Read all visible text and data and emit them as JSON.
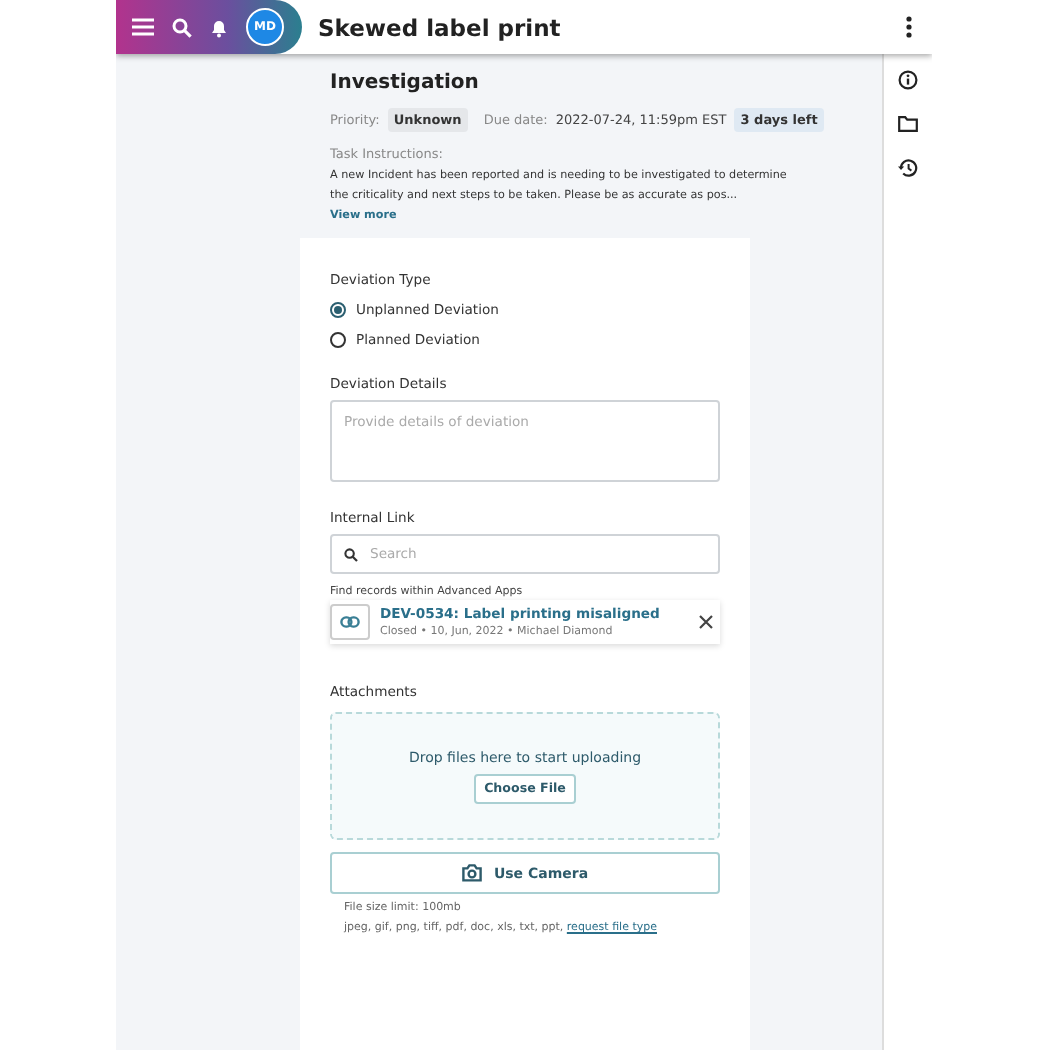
{
  "header": {
    "avatar": "MD",
    "title": "Skewed label print"
  },
  "task": {
    "title": "Investigation",
    "priority_label": "Priority:",
    "priority": "Unknown",
    "due_label": "Due date:",
    "due": "2022-07-24, 11:59pm EST",
    "due_badge": "3 days left",
    "instructions_label": "Task Instructions:",
    "instructions": "A new Incident has been reported and is needing to be investigated to determine the criticality and next steps to be taken. Please be as accurate as pos...",
    "view_more": "View more"
  },
  "form": {
    "type_label": "Deviation Type",
    "options": [
      {
        "label": "Unplanned Deviation",
        "selected": true
      },
      {
        "label": "Planned Deviation",
        "selected": false
      }
    ],
    "details_label": "Deviation Details",
    "details_placeholder": "Provide details of deviation",
    "link_label": "Internal Link",
    "search_placeholder": "Search",
    "search_hint": "Find records within Advanced Apps",
    "linked": {
      "title": "DEV-0534: Label printing misaligned",
      "meta": "Closed • 10, Jun, 2022 • Michael Diamond"
    },
    "attachments_label": "Attachments",
    "drop_text": "Drop files here to start uploading",
    "choose_button": "Choose File",
    "camera_button": "Use Camera",
    "size_limit": "File size limit: 100mb",
    "types": "jpeg, gif, png, tiff, pdf, doc, xls, txt, ppt,",
    "request_link": "request file type"
  }
}
